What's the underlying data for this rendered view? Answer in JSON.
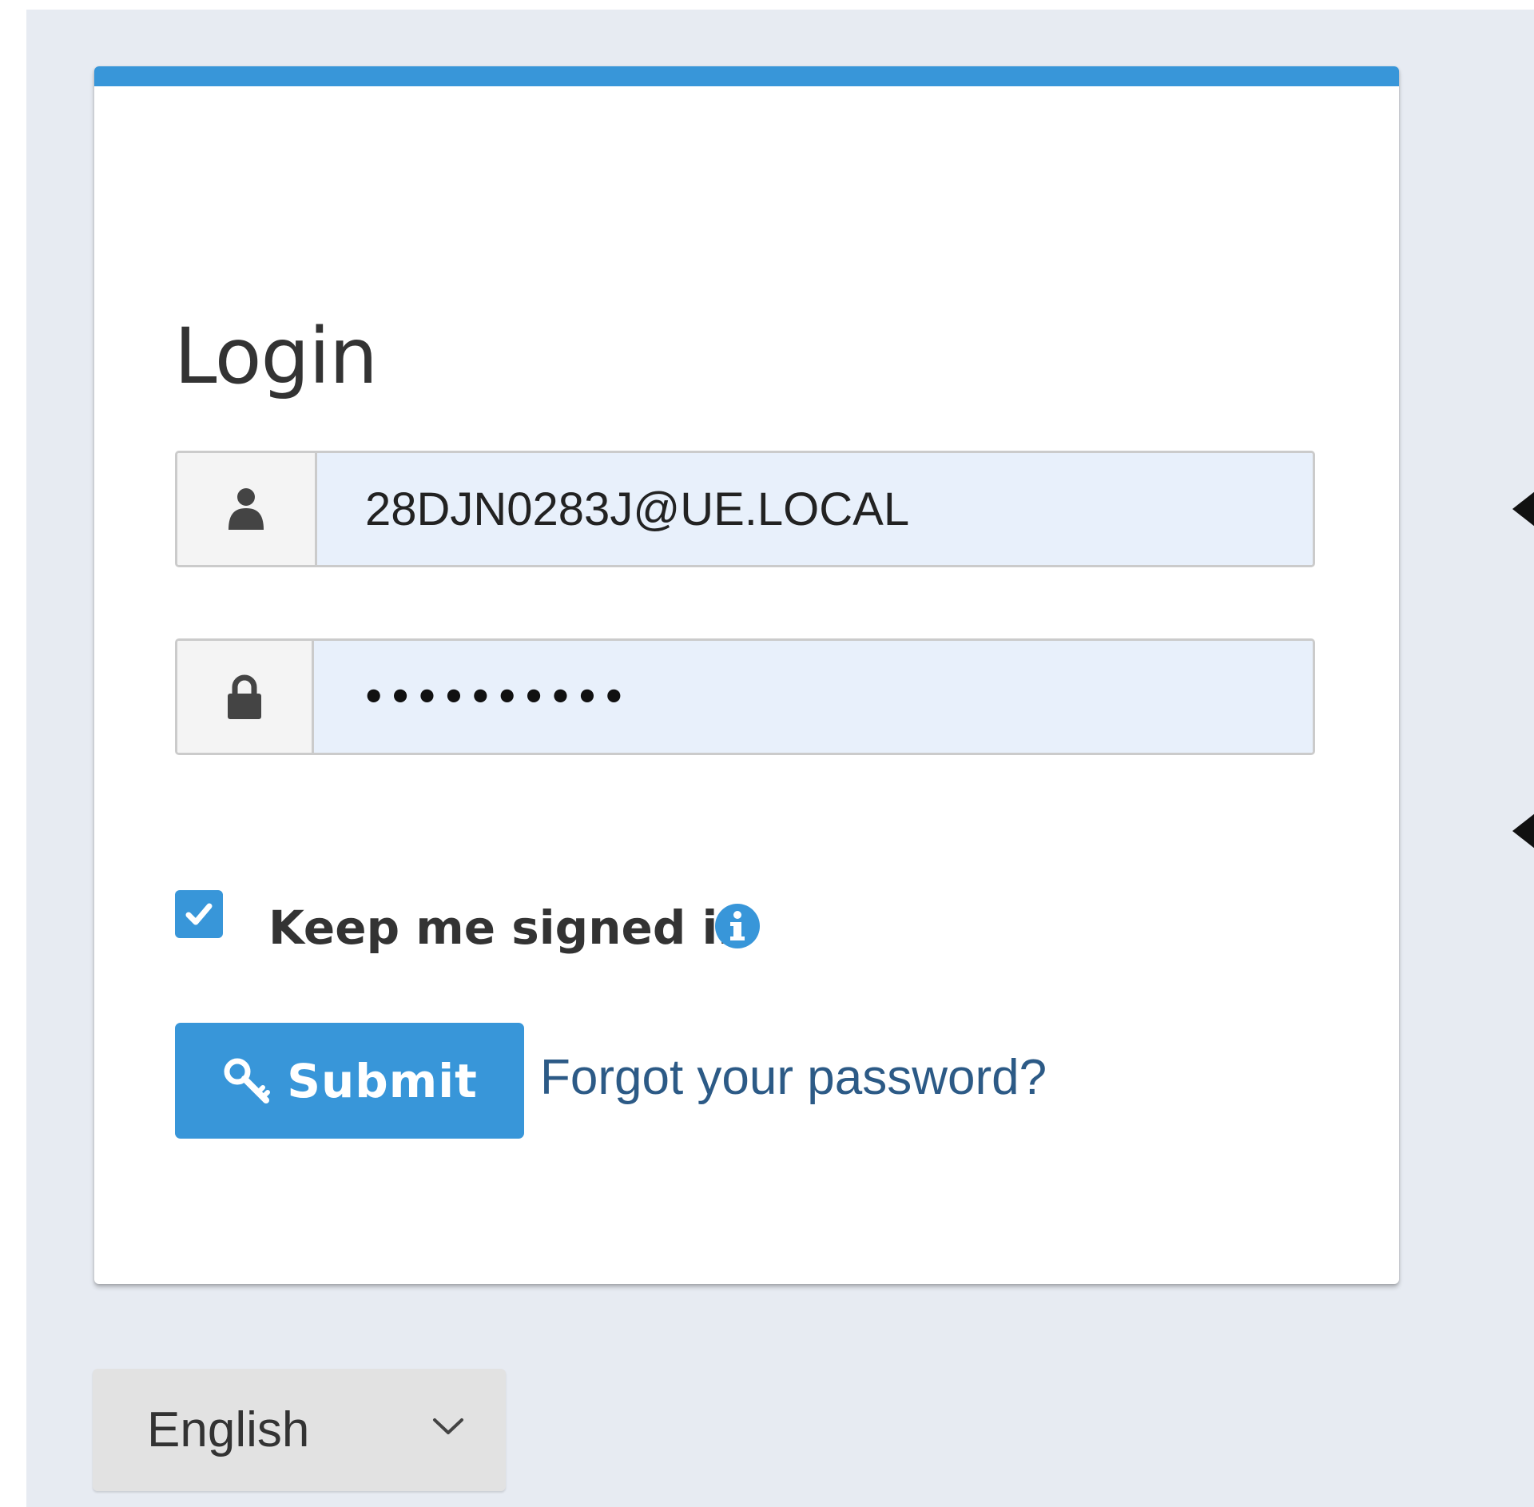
{
  "login": {
    "title": "Login",
    "username": {
      "value": "28DJN0283J@UE.LOCAL",
      "icon": "user-icon"
    },
    "password": {
      "value": "••••••••••",
      "icon": "lock-icon"
    },
    "keep_signed_in": {
      "label": "Keep me signed in",
      "checked": true,
      "info_icon": "info-icon"
    },
    "submit": {
      "label": "Submit",
      "icon": "key-icon"
    },
    "forgot_link": "Forgot your password?"
  },
  "language": {
    "selected": "English",
    "icon": "chevron-down-icon"
  },
  "colors": {
    "accent": "#3896d9",
    "background": "#e7ebf2",
    "input_fill": "#e8f0fb",
    "link": "#2c5a86"
  }
}
